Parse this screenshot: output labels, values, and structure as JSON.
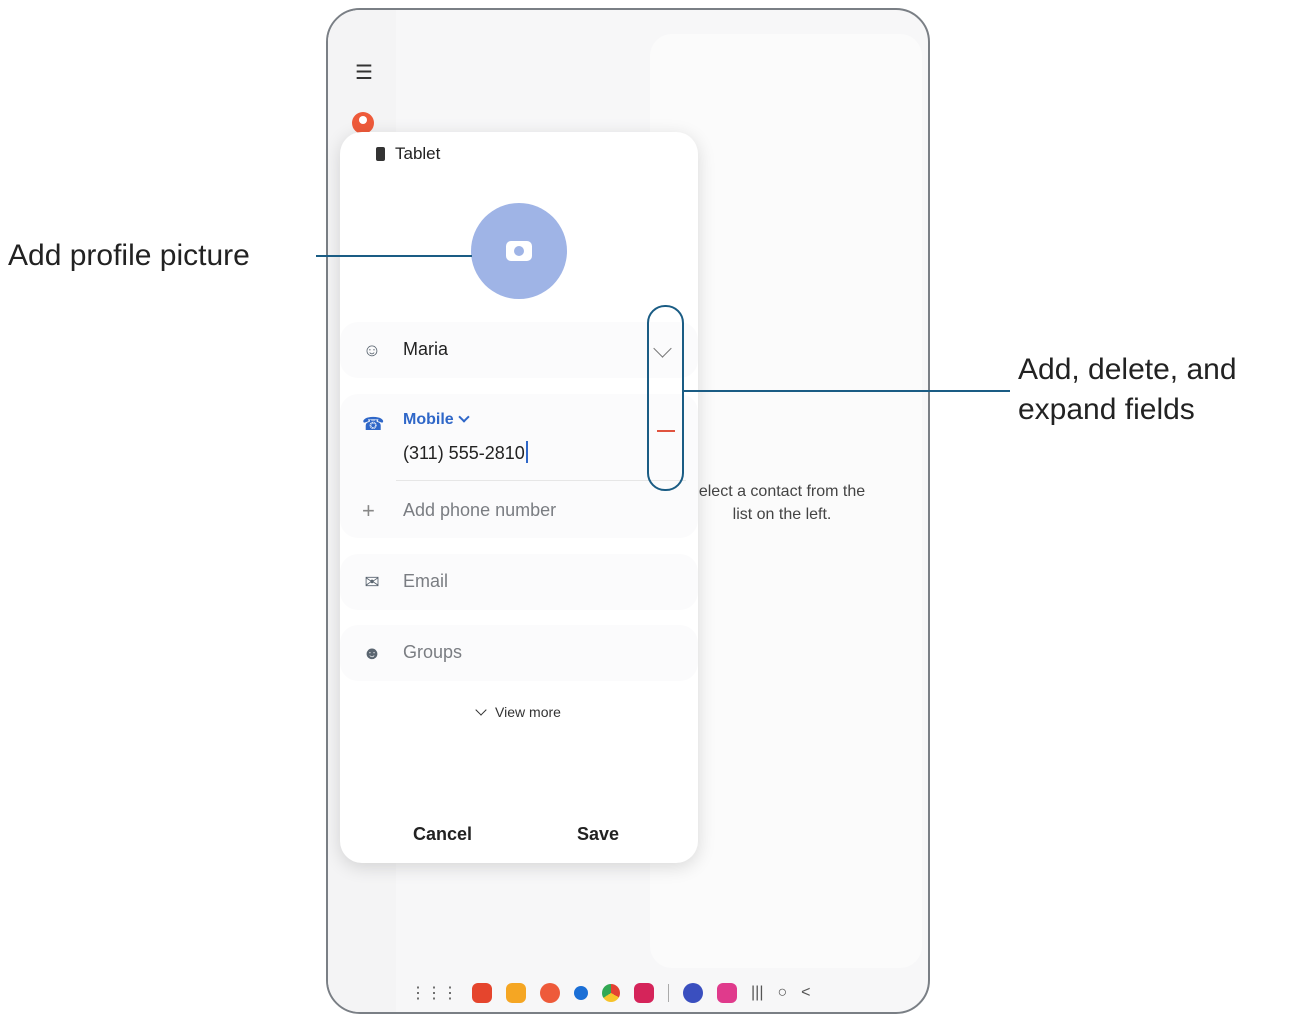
{
  "callouts": {
    "left": "Add profile picture",
    "right_line1": "Add, delete, and",
    "right_line2": "expand fields"
  },
  "list_pane": {
    "empty_message_line1": "elect a contact from the",
    "empty_message_line2": "list on the left."
  },
  "editor": {
    "storage_label": "Tablet",
    "name_value": "Maria",
    "phone_type": "Mobile",
    "phone_value": "(311) 555-2810",
    "add_phone_placeholder": "Add phone number",
    "email_placeholder": "Email",
    "groups_placeholder": "Groups",
    "view_more": "View more",
    "cancel": "Cancel",
    "save": "Save"
  },
  "colors": {
    "accent_blue": "#2f67c8",
    "delete_red": "#e0533f",
    "callout_line": "#1a5c84",
    "photo_circle": "#9fb4e6"
  },
  "nav_bar": {
    "apps": [
      "apps-grid",
      "app-red",
      "app-orange",
      "contacts",
      "messages",
      "chrome",
      "app-pink",
      "clock",
      "app-flower"
    ],
    "system": [
      "recents",
      "home",
      "back"
    ]
  }
}
